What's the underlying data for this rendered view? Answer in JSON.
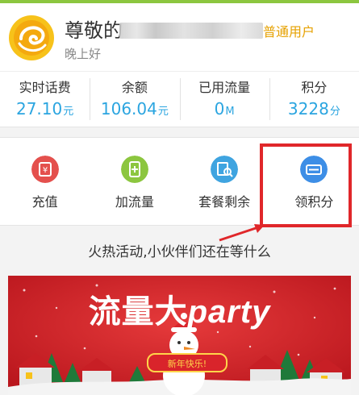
{
  "header": {
    "greeting_name": "尊敬的",
    "user_type": "普通用户",
    "greeting_time": "晚上好"
  },
  "stats": [
    {
      "label": "实时话费",
      "value": "27.10",
      "unit": "元"
    },
    {
      "label": "余额",
      "value": "106.04",
      "unit": "元"
    },
    {
      "label": "已用流量",
      "value": "0",
      "unit": "M"
    },
    {
      "label": "积分",
      "value": "3228",
      "unit": "分"
    }
  ],
  "actions": [
    {
      "label": "充值",
      "icon": "recharge-icon",
      "color": "#e4504d"
    },
    {
      "label": "加流量",
      "icon": "add-data-icon",
      "color": "#8cc63f"
    },
    {
      "label": "套餐剩余",
      "icon": "plan-remaining-icon",
      "color": "#3fa4e0"
    },
    {
      "label": "领积分",
      "icon": "points-card-icon",
      "color": "#3d8ee6"
    }
  ],
  "promo": {
    "title": "火热活动,小伙伴们还在等什么",
    "banner_title_cn": "流量大",
    "banner_title_en": "party",
    "banner_tag": "新年快乐!"
  },
  "colors": {
    "accent_blue": "#2ba5e0",
    "user_type": "#e6a100",
    "highlight": "#e0272a",
    "banner_red": "#d9242b"
  }
}
